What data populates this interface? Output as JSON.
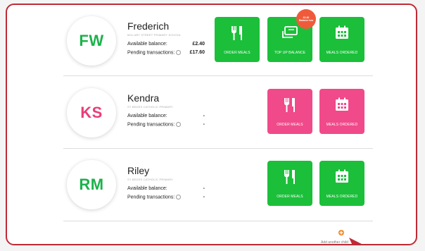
{
  "students": [
    {
      "initials": "FW",
      "name": "Frederich",
      "school": "MILLART STREET PRIMARY SCHOOL",
      "available_label": "Available balance:",
      "available_value": "£2.40",
      "pending_label": "Pending transactions:",
      "pending_value": "£17.60"
    },
    {
      "initials": "KS",
      "name": "Kendra",
      "school": "ST BEDES CATHOLIC PRIMARY",
      "available_label": "Available balance:",
      "available_value": "-",
      "pending_label": "Pending transactions:",
      "pending_value": "-"
    },
    {
      "initials": "RM",
      "name": "Riley",
      "school": "ST BEDES CATHOLIC PRIMARY",
      "available_label": "Available balance:",
      "available_value": "-",
      "pending_label": "Pending transactions:",
      "pending_value": "-"
    }
  ],
  "actions": {
    "order_meals": "ORDER MEALS",
    "top_up_balance": "TOP UP BALANCE",
    "meals_ordered": "MEALS ORDERED"
  },
  "badge_text": "£2.40 Balance low",
  "add_child": "Add another child",
  "colors": {
    "green": "#1bbf3a",
    "pink": "#f04a8a",
    "badge": "#ef5b3a",
    "frame": "#c02a35"
  },
  "icons": [
    "cutlery-icon",
    "card-swipe-icon",
    "calendar-icon",
    "info-icon",
    "add-child-icon"
  ]
}
